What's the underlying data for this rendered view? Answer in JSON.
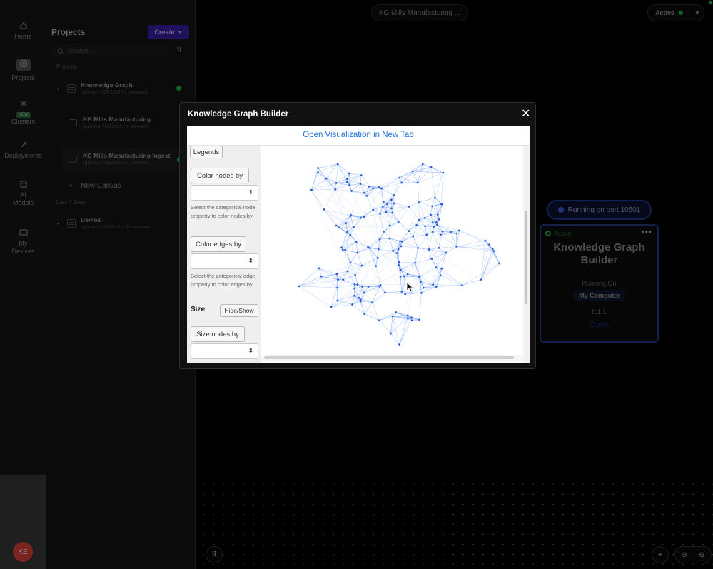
{
  "rail": {
    "items": [
      {
        "label": "Home",
        "icon": "home-icon"
      },
      {
        "label": "Projects",
        "icon": "projects-icon"
      },
      {
        "label": "Clusters",
        "icon": "clusters-icon",
        "badge": "NEW"
      },
      {
        "label": "Deployments",
        "icon": "rocket-icon"
      },
      {
        "label": "AI Models",
        "icon": "ai-models-icon"
      },
      {
        "label": "My Devices",
        "icon": "devices-icon"
      }
    ],
    "avatar": "KE"
  },
  "sidebar": {
    "title": "Projects",
    "create_label": "Create",
    "search_placeholder": "Search...",
    "section_projects": "Projects",
    "section_recent": "Last 7 Days",
    "projects": [
      {
        "name": "Knowledge Graph",
        "meta": "Updated 7/25/2025 • 2 canvases"
      },
      {
        "name": "Demos",
        "meta": "Updated 7/17/2025 • 20 canvases"
      }
    ],
    "canvases": [
      {
        "name": "KG Mills Manufacturing",
        "meta": "Updated 7/25/2025 • 3 elements"
      },
      {
        "name": "KG Mills Manufacturing Ingest",
        "meta": "Updated 7/25/2025 • 2 elements"
      }
    ],
    "new_canvas": "New Canvas"
  },
  "topbar": {
    "breadcrumb": "KG Mills Manufacturing ...",
    "status": "Active"
  },
  "canvas": {
    "port_label": "Running on port 10501",
    "node": {
      "status": "Active",
      "title_line1": "Knowledge Graph",
      "title_line2": "Builder",
      "running_on": "Running On",
      "computer": "My Computer",
      "version": "0.1.1",
      "open": "Open"
    }
  },
  "modal": {
    "title": "Knowledge Graph Builder",
    "link": "Open Visualization in New Tab",
    "panel": {
      "legends": "Legends",
      "color_nodes_by": "Color nodes by",
      "color_nodes_help": "Select the categorical node property to color nodes by",
      "color_nodes_value": "",
      "color_edges_by": "Color edges by",
      "color_edges_help": "Select the categorical edge property to color edges by",
      "color_edges_value": "",
      "size": "Size",
      "hide_show": "Hide/Show",
      "size_nodes_by": "Size nodes by",
      "size_nodes_value": ""
    }
  },
  "colors": {
    "accent": "#3b1fae",
    "active_green": "#1fb34a",
    "node_border": "#1f3c8a",
    "graph_edge": "#7aa6ff",
    "graph_node": "#2a5fd8",
    "link_blue": "#2475d8",
    "avatar": "#e0433a"
  }
}
